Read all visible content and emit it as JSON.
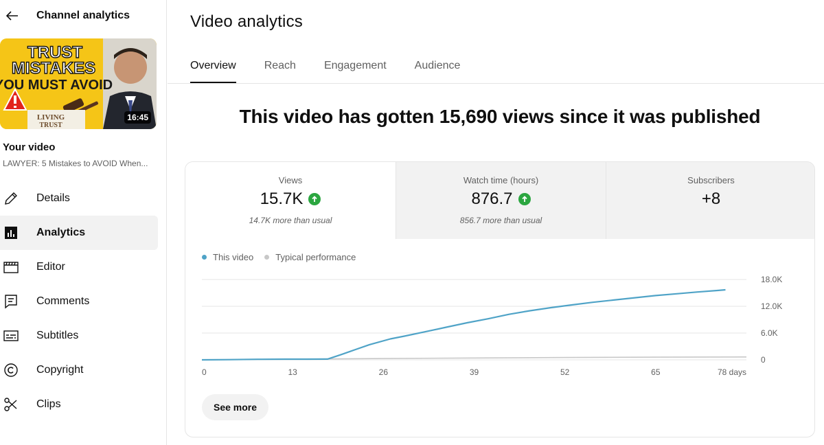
{
  "sidebar": {
    "title": "Channel analytics",
    "back_icon": "arrow-left-icon",
    "thumbnail": {
      "line1": "TRUST",
      "line2": "MISTAKES",
      "line3": "YOU MUST AVOID",
      "badge_line1": "LIVING",
      "badge_line2": "TRUST",
      "duration": "16:45"
    },
    "your_video_label": "Your video",
    "video_title": "LAWYER: 5 Mistakes to AVOID When...",
    "items": [
      {
        "label": "Details",
        "icon": "pencil-icon"
      },
      {
        "label": "Analytics",
        "icon": "analytics-icon"
      },
      {
        "label": "Editor",
        "icon": "clapperboard-icon"
      },
      {
        "label": "Comments",
        "icon": "comment-icon"
      },
      {
        "label": "Subtitles",
        "icon": "subtitles-icon"
      },
      {
        "label": "Copyright",
        "icon": "copyright-icon"
      },
      {
        "label": "Clips",
        "icon": "scissors-icon"
      }
    ],
    "active_item": "Analytics"
  },
  "main": {
    "title": "Video analytics",
    "tabs": [
      {
        "label": "Overview"
      },
      {
        "label": "Reach"
      },
      {
        "label": "Engagement"
      },
      {
        "label": "Audience"
      }
    ],
    "active_tab": "Overview",
    "headline": "This video has gotten 15,690 views since it was published",
    "metrics": [
      {
        "label": "Views",
        "value": "15.7K",
        "note": "14.7K more than usual",
        "trend": "up"
      },
      {
        "label": "Watch time (hours)",
        "value": "876.7",
        "note": "856.7 more than usual",
        "trend": "up"
      },
      {
        "label": "Subscribers",
        "value": "+8",
        "note": "",
        "trend": ""
      }
    ],
    "legend": [
      {
        "label": "This video",
        "color": "#4fa3c7"
      },
      {
        "label": "Typical performance",
        "color": "#c8c8c8"
      }
    ],
    "see_more_label": "See more"
  },
  "colors": {
    "accent_up": "#2ba640",
    "series_line": "#4fa3c7",
    "typical_line": "#c8c8c8"
  },
  "chart_data": {
    "type": "line",
    "x_tick_labels": [
      "0",
      "13",
      "26",
      "39",
      "52",
      "65",
      "78 days"
    ],
    "y_tick_labels": [
      "0",
      "6.0K",
      "12.0K",
      "18.0K"
    ],
    "xlim": [
      0,
      78
    ],
    "ylim": [
      0,
      18000
    ],
    "grid": true,
    "legend_position": "top-left",
    "series": [
      {
        "name": "This video",
        "x": [
          0,
          4,
          8,
          12,
          15,
          18,
          20,
          22,
          24,
          27,
          29,
          32,
          35,
          38,
          41,
          44,
          47,
          50,
          53,
          56,
          59,
          62,
          65,
          68,
          71,
          74,
          75
        ],
        "y": [
          0,
          50,
          130,
          150,
          160,
          170,
          1200,
          2300,
          3400,
          4700,
          5300,
          6300,
          7300,
          8300,
          9200,
          10200,
          11000,
          11700,
          12300,
          12900,
          13400,
          13900,
          14400,
          14800,
          15200,
          15550,
          15690
        ]
      },
      {
        "name": "Typical performance",
        "x": [
          0,
          13,
          26,
          39,
          52,
          65,
          78
        ],
        "y": [
          0,
          150,
          300,
          420,
          520,
          600,
          650
        ]
      }
    ]
  }
}
